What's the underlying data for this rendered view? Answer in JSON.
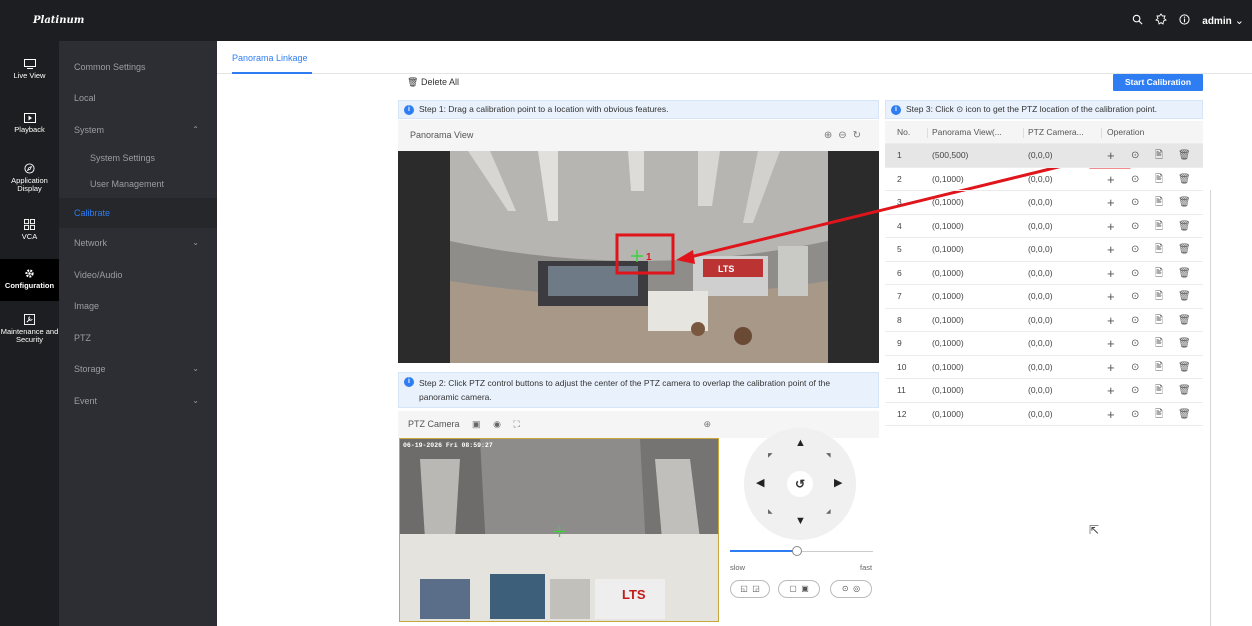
{
  "app": {
    "logo": "Platinum",
    "user": "admin"
  },
  "topbar_icons": [
    "search-icon",
    "theme-icon",
    "info-icon"
  ],
  "rail": [
    {
      "id": "live-view",
      "label": "Live View",
      "icon": "monitor-icon"
    },
    {
      "id": "playback",
      "label": "Playback",
      "icon": "play-icon"
    },
    {
      "id": "application-display",
      "label": "Application Display",
      "icon": "compass-icon"
    },
    {
      "id": "vca",
      "label": "VCA",
      "icon": "grid-icon"
    },
    {
      "id": "configuration",
      "label": "Configuration",
      "icon": "gear-icon",
      "active": true
    },
    {
      "id": "maintenance",
      "label": "Maintenance and Security",
      "icon": "wrench-icon"
    }
  ],
  "submenu": [
    {
      "label": "Common Settings"
    },
    {
      "label": "Local"
    },
    {
      "label": "System",
      "expand": "up"
    },
    {
      "label": "System Settings",
      "child": true
    },
    {
      "label": "User Management",
      "child": true
    },
    {
      "label": "Calibrate",
      "active": true
    },
    {
      "label": "Network",
      "expand": "down"
    },
    {
      "label": "Video/Audio"
    },
    {
      "label": "Image"
    },
    {
      "label": "PTZ"
    },
    {
      "label": "Storage",
      "expand": "down"
    },
    {
      "label": "Event",
      "expand": "down"
    }
  ],
  "tab": {
    "label": "Panorama Linkage"
  },
  "toolbar": {
    "delete_all": "Delete All",
    "start_calibration": "Start Calibration"
  },
  "step1": "Step 1: Drag a calibration point to a location with obvious features.",
  "step2": "Step 2: Click PTZ control buttons to adjust the center of the PTZ camera to overlap the calibration point of the panoramic camera.",
  "step3": {
    "before": "Step 3: Click ",
    "after": " icon to get the PTZ location of the calibration point."
  },
  "panorama_view": {
    "title": "Panorama View"
  },
  "ptz_camera": {
    "title": "PTZ Camera",
    "timestamp": "06-19-2026 Fri 08:59:27"
  },
  "image_signage": "LTS",
  "table": {
    "headers": {
      "no": "No.",
      "panorama": "Panorama View(...",
      "ptz": "PTZ Camera...",
      "operation": "Operation"
    },
    "rows": [
      {
        "no": "1",
        "panorama": "(500,500)",
        "ptz": "(0,0,0)"
      },
      {
        "no": "2",
        "panorama": "(0,1000)",
        "ptz": "(0,0,0)"
      },
      {
        "no": "3",
        "panorama": "(0,1000)",
        "ptz": "(0,0,0)"
      },
      {
        "no": "4",
        "panorama": "(0,1000)",
        "ptz": "(0,0,0)"
      },
      {
        "no": "5",
        "panorama": "(0,1000)",
        "ptz": "(0,0,0)"
      },
      {
        "no": "6",
        "panorama": "(0,1000)",
        "ptz": "(0,0,0)"
      },
      {
        "no": "7",
        "panorama": "(0,1000)",
        "ptz": "(0,0,0)"
      },
      {
        "no": "8",
        "panorama": "(0,1000)",
        "ptz": "(0,0,0)"
      },
      {
        "no": "9",
        "panorama": "(0,1000)",
        "ptz": "(0,0,0)"
      },
      {
        "no": "10",
        "panorama": "(0,1000)",
        "ptz": "(0,0,0)"
      },
      {
        "no": "11",
        "panorama": "(0,1000)",
        "ptz": "(0,0,0)"
      },
      {
        "no": "12",
        "panorama": "(0,1000)",
        "ptz": "(0,0,0)"
      }
    ]
  },
  "ptz_control": {
    "slow": "slow",
    "fast": "fast",
    "speed_percent": 47
  },
  "colors": {
    "accent": "#2e7df2",
    "annotation": "#e0141b",
    "marker": "#3ad13a"
  }
}
